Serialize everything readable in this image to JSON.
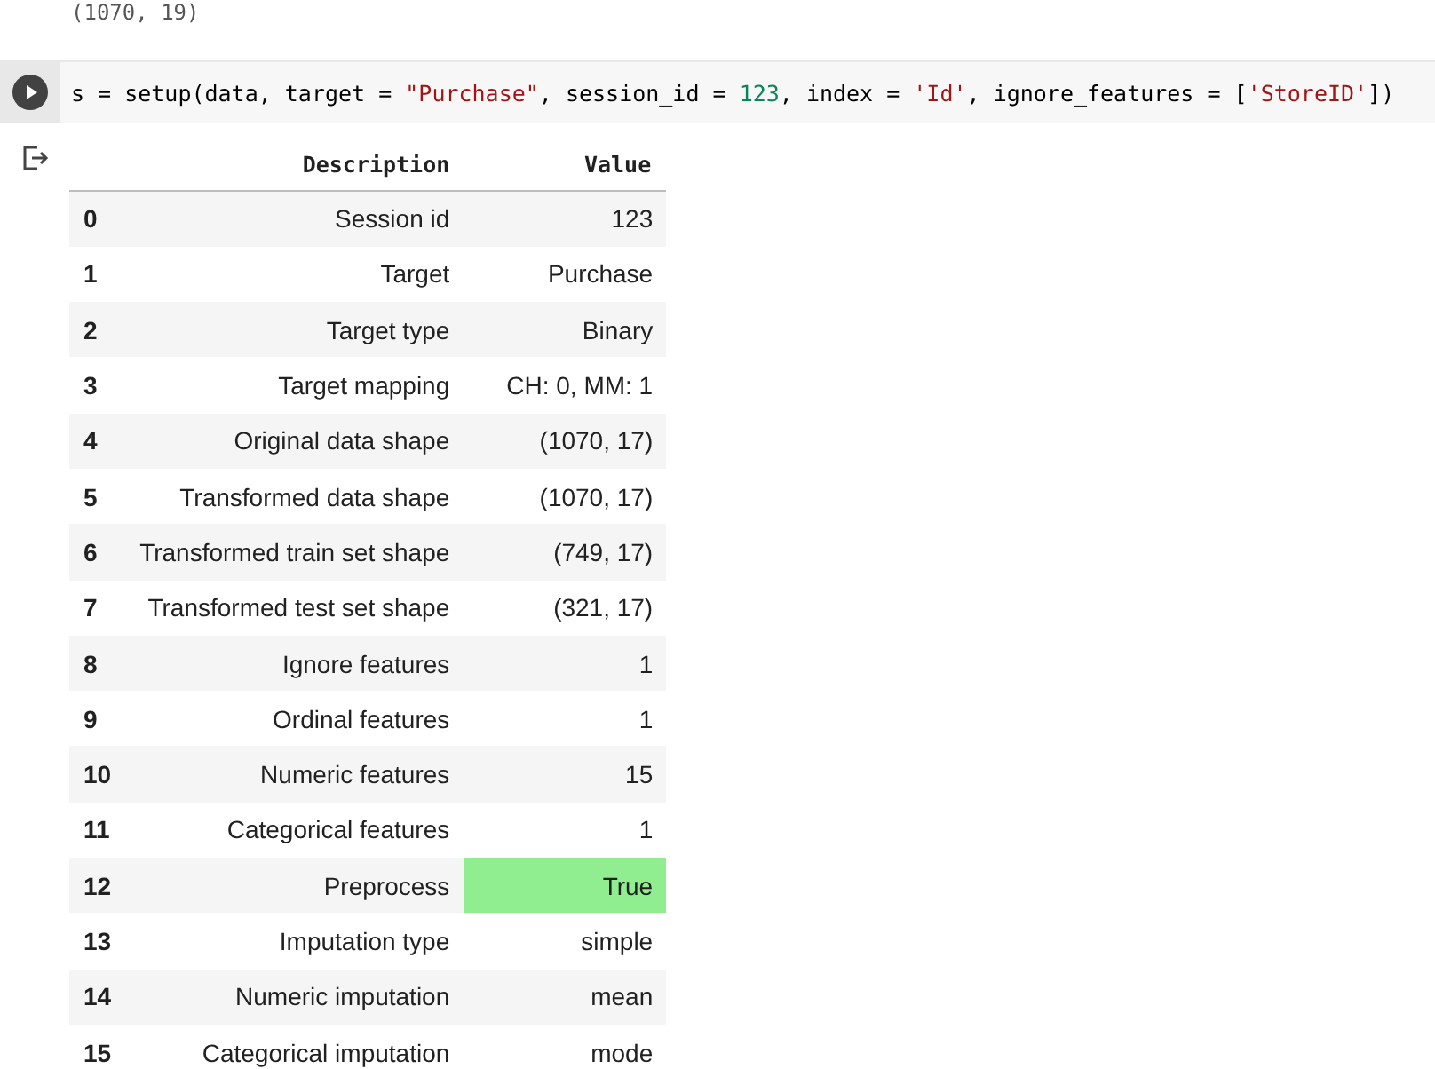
{
  "previous_output": "(1070, 19)",
  "code_cell": {
    "tokens": [
      {
        "text": "s = setup(data, target = ",
        "kind": "plain"
      },
      {
        "text": "\"Purchase\"",
        "kind": "string"
      },
      {
        "text": ", session_id = ",
        "kind": "plain"
      },
      {
        "text": "123",
        "kind": "number"
      },
      {
        "text": ", index = ",
        "kind": "plain"
      },
      {
        "text": "'Id'",
        "kind": "string"
      },
      {
        "text": ", ignore_features = [",
        "kind": "plain"
      },
      {
        "text": "'StoreID'",
        "kind": "string"
      },
      {
        "text": "])",
        "kind": "plain"
      }
    ]
  },
  "table": {
    "columns": [
      "Description",
      "Value"
    ],
    "rows": [
      {
        "index": "0",
        "description": "Session id",
        "value": "123",
        "highlighted": false
      },
      {
        "index": "1",
        "description": "Target",
        "value": "Purchase",
        "highlighted": false
      },
      {
        "index": "2",
        "description": "Target type",
        "value": "Binary",
        "highlighted": false
      },
      {
        "index": "3",
        "description": "Target mapping",
        "value": "CH: 0, MM: 1",
        "highlighted": false
      },
      {
        "index": "4",
        "description": "Original data shape",
        "value": "(1070, 17)",
        "highlighted": false
      },
      {
        "index": "5",
        "description": "Transformed data shape",
        "value": "(1070, 17)",
        "highlighted": false
      },
      {
        "index": "6",
        "description": "Transformed train set shape",
        "value": "(749, 17)",
        "highlighted": false
      },
      {
        "index": "7",
        "description": "Transformed test set shape",
        "value": "(321, 17)",
        "highlighted": false
      },
      {
        "index": "8",
        "description": "Ignore features",
        "value": "1",
        "highlighted": false
      },
      {
        "index": "9",
        "description": "Ordinal features",
        "value": "1",
        "highlighted": false
      },
      {
        "index": "10",
        "description": "Numeric features",
        "value": "15",
        "highlighted": false
      },
      {
        "index": "11",
        "description": "Categorical features",
        "value": "1",
        "highlighted": false
      },
      {
        "index": "12",
        "description": "Preprocess",
        "value": "True",
        "highlighted": true
      },
      {
        "index": "13",
        "description": "Imputation type",
        "value": "simple",
        "highlighted": false
      },
      {
        "index": "14",
        "description": "Numeric imputation",
        "value": "mean",
        "highlighted": false
      },
      {
        "index": "15",
        "description": "Categorical imputation",
        "value": "mode",
        "highlighted": false
      }
    ]
  }
}
